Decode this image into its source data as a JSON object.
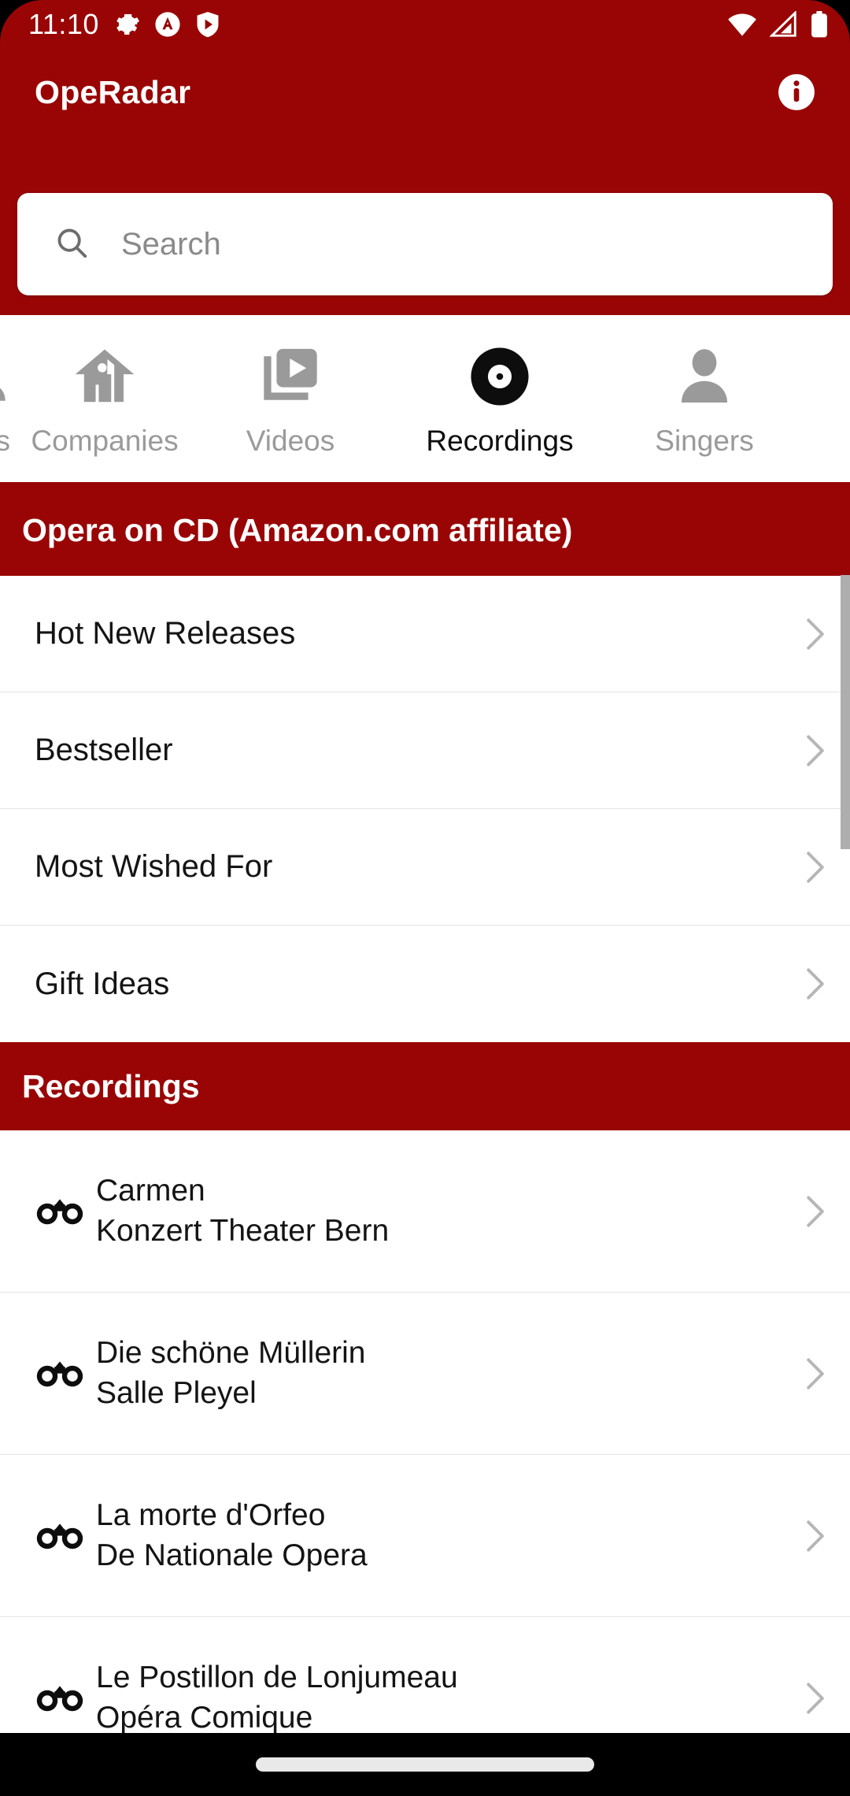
{
  "theme": {
    "brand": "#990505",
    "accent_text": "#ffffff",
    "muted": "#9a9a9a"
  },
  "status_bar": {
    "time": "11:10",
    "left_icons": [
      "gear-icon",
      "circle-a-icon",
      "shield-play-icon"
    ],
    "right_icons": [
      "wifi-icon",
      "cellular-signal-icon",
      "battery-icon"
    ]
  },
  "app_bar": {
    "title": "OpeRadar",
    "info_icon": "info-icon"
  },
  "search": {
    "placeholder": "Search",
    "value": "",
    "icon": "search-icon"
  },
  "tabs": {
    "selected": "Recordings",
    "items": [
      {
        "label": "sers",
        "icon": "composer-icon",
        "active": false
      },
      {
        "label": "Companies",
        "icon": "house-icon",
        "active": false
      },
      {
        "label": "Videos",
        "icon": "video-library-icon",
        "active": false
      },
      {
        "label": "Recordings",
        "icon": "vinyl-record-icon",
        "active": true
      },
      {
        "label": "Singers",
        "icon": "person-icon",
        "active": false
      }
    ]
  },
  "sections": [
    {
      "title": "Opera on CD (Amazon.com affiliate)",
      "type": "links",
      "items": [
        {
          "label": "Hot New Releases",
          "chevron": "chevron-right-icon"
        },
        {
          "label": "Bestseller",
          "chevron": "chevron-right-icon"
        },
        {
          "label": "Most Wished For",
          "chevron": "chevron-right-icon"
        },
        {
          "label": "Gift Ideas",
          "chevron": "chevron-right-icon"
        }
      ]
    },
    {
      "title": "Recordings",
      "type": "recordings",
      "items": [
        {
          "title": "Carmen",
          "subtitle": "Konzert Theater Bern",
          "icon": "binoculars-icon",
          "chevron": "chevron-right-icon"
        },
        {
          "title": "Die schöne Müllerin",
          "subtitle": "Salle Pleyel",
          "icon": "binoculars-icon",
          "chevron": "chevron-right-icon"
        },
        {
          "title": "La morte d'Orfeo",
          "subtitle": "De Nationale Opera",
          "icon": "binoculars-icon",
          "chevron": "chevron-right-icon"
        },
        {
          "title": "Le Postillon de Lonjumeau",
          "subtitle": "Opéra Comique",
          "icon": "binoculars-icon",
          "chevron": "chevron-right-icon"
        }
      ]
    }
  ],
  "scrollbar": {
    "visible": true
  },
  "nav_bar": {
    "gesture_pill": true
  }
}
